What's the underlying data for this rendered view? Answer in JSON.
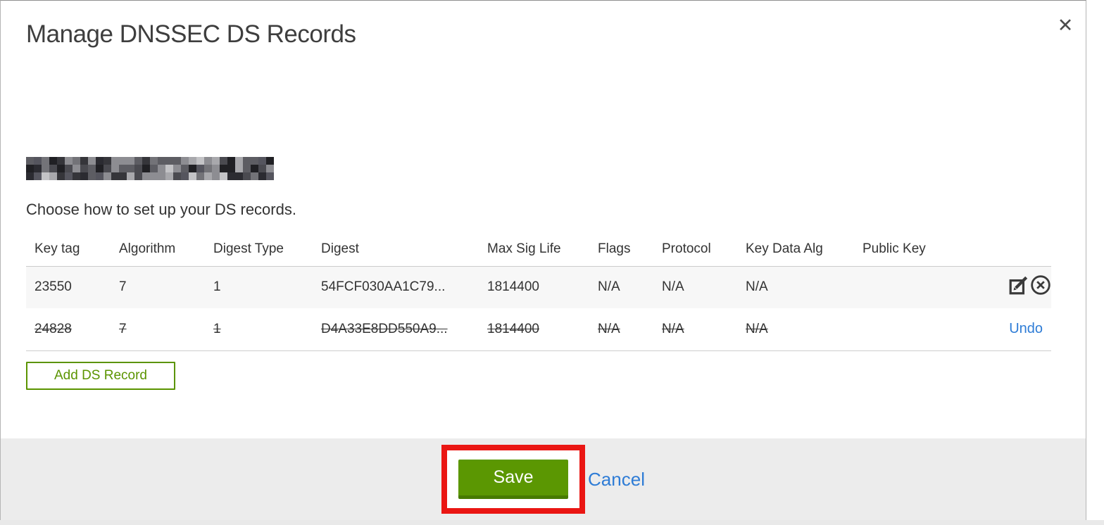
{
  "modal": {
    "title": "Manage DNSSEC DS Records",
    "close_glyph": "✕",
    "subtitle": "Choose how to set up your DS records.",
    "add_button_label": "Add DS Record",
    "save_label": "Save",
    "cancel_label": "Cancel"
  },
  "table": {
    "headers": [
      "Key tag",
      "Algorithm",
      "Digest Type",
      "Digest",
      "Max Sig Life",
      "Flags",
      "Protocol",
      "Key Data Alg",
      "Public Key"
    ],
    "rows": [
      {
        "cells": [
          "23550",
          "7",
          "1",
          "54FCF030AA1C79...",
          "1814400",
          "N/A",
          "N/A",
          "N/A",
          ""
        ],
        "deleted": false,
        "action": "edit-delete"
      },
      {
        "cells": [
          "24828",
          "7",
          "1",
          "D4A33E8DD550A9...",
          "1814400",
          "N/A",
          "N/A",
          "N/A",
          ""
        ],
        "deleted": true,
        "action": "undo",
        "undo_label": "Undo"
      }
    ]
  },
  "colors": {
    "accent_green": "#5b9702",
    "link_blue": "#2e7cd6",
    "annotation_red": "#ea1613",
    "footer_gray": "#ececec",
    "row_stripe": "#f7f7f7"
  }
}
